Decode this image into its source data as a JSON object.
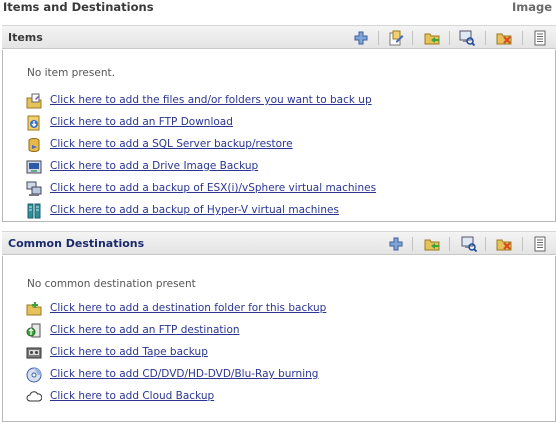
{
  "header": {
    "title": "Items and Destinations",
    "right_label": "Image"
  },
  "items": {
    "section_label": "Items",
    "empty_text": "No item present.",
    "toolbar": [
      "add-icon",
      "edit-icon",
      "open-folder-icon",
      "browse-icon",
      "delete-icon",
      "properties-icon"
    ],
    "links": [
      {
        "icon": "files-folders-icon",
        "label": "Click here to add the files and/or folders you want to back up"
      },
      {
        "icon": "ftp-download-icon",
        "label": "Click here to add an FTP Download"
      },
      {
        "icon": "sql-server-icon",
        "label": "Click here to add a SQL Server backup/restore"
      },
      {
        "icon": "drive-image-icon",
        "label": "Click here to add a Drive Image Backup"
      },
      {
        "icon": "vsphere-icon",
        "label": "Click here to add a backup of ESX(i)/vSphere virtual machines"
      },
      {
        "icon": "hyperv-icon",
        "label": "Click here to add a backup of Hyper-V virtual machines"
      }
    ]
  },
  "destinations": {
    "section_label": "Common Destinations",
    "empty_text": "No common destination present",
    "toolbar": [
      "add-icon",
      "open-folder-icon",
      "browse-icon",
      "delete-icon",
      "properties-icon"
    ],
    "links": [
      {
        "icon": "destination-folder-icon",
        "label": "Click here to add a destination folder for this backup"
      },
      {
        "icon": "ftp-destination-icon",
        "label": "Click here to add an FTP destination"
      },
      {
        "icon": "tape-icon",
        "label": "Click here to add Tape backup"
      },
      {
        "icon": "disc-icon",
        "label": "Click here to add CD/DVD/HD-DVD/Blu-Ray burning"
      },
      {
        "icon": "cloud-icon",
        "label": "Click here to add Cloud Backup"
      }
    ]
  },
  "colors": {
    "link": "#2b3590",
    "destinations_header": "#1b2a6b",
    "delete": "#d94a1e",
    "folder": "#e6c25a"
  }
}
